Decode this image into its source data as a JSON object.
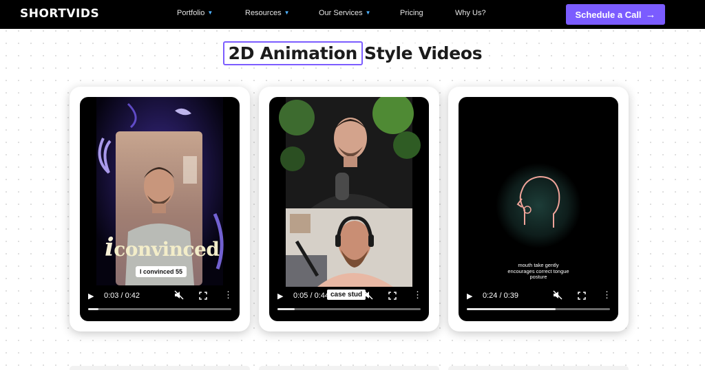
{
  "nav": {
    "logo": "SHORTVIDS",
    "items": [
      {
        "label": "Portfolio",
        "dropdown": true
      },
      {
        "label": "Resources",
        "dropdown": true
      },
      {
        "label": "Our Services",
        "dropdown": true
      },
      {
        "label": "Pricing",
        "dropdown": false
      },
      {
        "label": "Why Us?",
        "dropdown": false
      }
    ],
    "cta_label": "Schedule a Call",
    "cta_arrow": "→"
  },
  "heading": {
    "highlight": "2D Animation",
    "rest": "Style Videos"
  },
  "videos": [
    {
      "time": "0:03 / 0:42",
      "progress": 0.07,
      "overlay_word": "convinced",
      "overlay_letter": "i",
      "caption": "I convinced 55"
    },
    {
      "time": "0:05 / 0:44",
      "progress": 0.12,
      "caption": "case stud"
    },
    {
      "time": "0:24 / 0:39",
      "progress": 0.62,
      "caption": "mouth take gently encourages correct tongue posture"
    }
  ],
  "colors": {
    "accent": "#7b5cff",
    "chevron": "#4fb3ff",
    "nav_bg": "#000000"
  }
}
